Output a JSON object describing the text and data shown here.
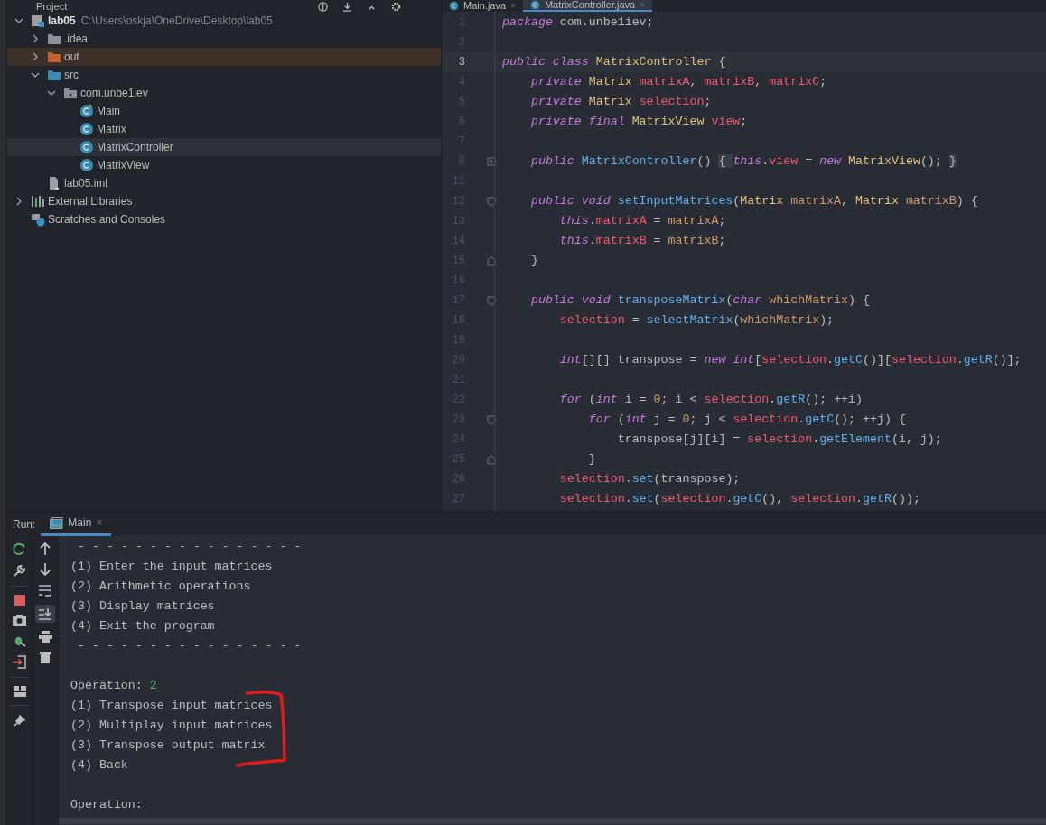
{
  "project_panel": {
    "title": "Project",
    "tree": [
      {
        "label": "lab05",
        "path": "C:\\Users\\oskja\\OneDrive\\Desktop\\lab05",
        "kind": "module",
        "expanded": true,
        "selected": false,
        "excluded": false,
        "children": [
          {
            "label": ".idea",
            "kind": "folder",
            "expanded": false,
            "selected": false,
            "excluded": false
          },
          {
            "label": "out",
            "kind": "excluded-folder",
            "expanded": false,
            "selected": false,
            "excluded": true
          },
          {
            "label": "src",
            "kind": "source-folder",
            "expanded": true,
            "selected": false,
            "excluded": false,
            "children": [
              {
                "label": "com.unbe1iev",
                "kind": "package",
                "expanded": true,
                "selected": false,
                "excluded": false,
                "children": [
                  {
                    "label": "Main",
                    "kind": "main-class",
                    "selected": false,
                    "excluded": false
                  },
                  {
                    "label": "Matrix",
                    "kind": "class",
                    "selected": false,
                    "excluded": false
                  },
                  {
                    "label": "MatrixController",
                    "kind": "class",
                    "selected": true,
                    "excluded": false
                  },
                  {
                    "label": "MatrixView",
                    "kind": "class",
                    "selected": false,
                    "excluded": false
                  }
                ]
              }
            ]
          },
          {
            "label": "lab05.iml",
            "kind": "file",
            "selected": false,
            "excluded": false
          }
        ]
      },
      {
        "label": "External Libraries",
        "kind": "libraries",
        "expanded": false,
        "selected": false,
        "excluded": false
      },
      {
        "label": "Scratches and Consoles",
        "kind": "scratches",
        "selected": false,
        "excluded": false
      }
    ]
  },
  "editor": {
    "tabs": [
      {
        "label": "Main.java",
        "close": "×",
        "selected": false
      },
      {
        "label": "MatrixController.java",
        "close": "×",
        "selected": true
      }
    ],
    "lines": [
      {
        "n": "1",
        "current": false,
        "tokens": [
          {
            "kind": "kw",
            "text": "package "
          },
          {
            "kind": "plain",
            "text": "com.unbe1iev;"
          }
        ]
      },
      {
        "n": "2",
        "current": false
      },
      {
        "n": "3",
        "current": true,
        "tokens": [
          {
            "kind": "kw",
            "text": "public class "
          },
          {
            "kind": "type",
            "text": "MatrixController"
          },
          {
            "kind": "plain",
            "text": " {"
          }
        ]
      },
      {
        "n": "4",
        "current": false,
        "tokens": [
          {
            "kind": "kw",
            "text": "    private "
          },
          {
            "kind": "type",
            "text": "Matrix "
          },
          {
            "kind": "field",
            "text": "matrixA"
          },
          {
            "kind": "plain",
            "text": ", "
          },
          {
            "kind": "field",
            "text": "matrixB"
          },
          {
            "kind": "plain",
            "text": ", "
          },
          {
            "kind": "field",
            "text": "matrixC"
          },
          {
            "kind": "plain",
            "text": ";"
          }
        ]
      },
      {
        "n": "5",
        "current": false,
        "tokens": [
          {
            "kind": "kw",
            "text": "    private "
          },
          {
            "kind": "type",
            "text": "Matrix "
          },
          {
            "kind": "field",
            "text": "selection"
          },
          {
            "kind": "plain",
            "text": ";"
          }
        ]
      },
      {
        "n": "6",
        "current": false,
        "tokens": [
          {
            "kind": "kw",
            "text": "    private final "
          },
          {
            "kind": "type",
            "text": "MatrixView "
          },
          {
            "kind": "field",
            "text": "view"
          },
          {
            "kind": "plain",
            "text": ";"
          }
        ]
      },
      {
        "n": "7",
        "current": false
      },
      {
        "n": "8",
        "current": false,
        "kind": "folded",
        "tokens": [
          {
            "kind": "kw",
            "text": "    public "
          },
          {
            "kind": "fn",
            "text": "MatrixController"
          },
          {
            "kind": "plain",
            "text": "() "
          },
          {
            "kind": "folded",
            "text": "{ "
          },
          {
            "kind": "kw",
            "text": "this"
          },
          {
            "kind": "plain",
            "text": "."
          },
          {
            "kind": "field",
            "text": "view"
          },
          {
            "kind": "plain",
            "text": " = "
          },
          {
            "kind": "kw",
            "text": "new "
          },
          {
            "kind": "type",
            "text": "MatrixView"
          },
          {
            "kind": "plain",
            "text": "(); "
          },
          {
            "kind": "folded",
            "text": "}"
          }
        ]
      },
      {
        "n": "11",
        "current": false
      },
      {
        "n": "12",
        "current": false,
        "kind": "fold-start",
        "tokens": [
          {
            "kind": "kw",
            "text": "    public void "
          },
          {
            "kind": "fn",
            "text": "setInputMatrices"
          },
          {
            "kind": "plain",
            "text": "("
          },
          {
            "kind": "type",
            "text": "Matrix "
          },
          {
            "kind": "param",
            "text": "matrixA"
          },
          {
            "kind": "plain",
            "text": ", "
          },
          {
            "kind": "type",
            "text": "Matrix "
          },
          {
            "kind": "param",
            "text": "matrixB"
          },
          {
            "kind": "plain",
            "text": ") {"
          }
        ]
      },
      {
        "n": "13",
        "current": false,
        "tokens": [
          {
            "kind": "kw",
            "text": "        this"
          },
          {
            "kind": "plain",
            "text": "."
          },
          {
            "kind": "field",
            "text": "matrixA"
          },
          {
            "kind": "plain",
            "text": " = "
          },
          {
            "kind": "param",
            "text": "matrixA"
          },
          {
            "kind": "plain",
            "text": ";"
          }
        ]
      },
      {
        "n": "14",
        "current": false,
        "tokens": [
          {
            "kind": "kw",
            "text": "        this"
          },
          {
            "kind": "plain",
            "text": "."
          },
          {
            "kind": "field",
            "text": "matrixB"
          },
          {
            "kind": "plain",
            "text": " = "
          },
          {
            "kind": "param",
            "text": "matrixB"
          },
          {
            "kind": "plain",
            "text": ";"
          }
        ]
      },
      {
        "n": "15",
        "current": false,
        "kind": "fold-end",
        "tokens": [
          {
            "kind": "plain",
            "text": "    }"
          }
        ]
      },
      {
        "n": "16",
        "current": false
      },
      {
        "n": "17",
        "current": false,
        "kind": "fold-start",
        "tokens": [
          {
            "kind": "kw",
            "text": "    public void "
          },
          {
            "kind": "fn",
            "text": "transposeMatrix"
          },
          {
            "kind": "plain",
            "text": "("
          },
          {
            "kind": "kw",
            "text": "char "
          },
          {
            "kind": "param",
            "text": "whichMatrix"
          },
          {
            "kind": "plain",
            "text": ") {"
          }
        ]
      },
      {
        "n": "18",
        "current": false,
        "tokens": [
          {
            "kind": "field",
            "text": "        selection"
          },
          {
            "kind": "plain",
            "text": " = "
          },
          {
            "kind": "fn",
            "text": "selectMatrix"
          },
          {
            "kind": "plain",
            "text": "("
          },
          {
            "kind": "param",
            "text": "whichMatrix"
          },
          {
            "kind": "plain",
            "text": ");"
          }
        ]
      },
      {
        "n": "19",
        "current": false
      },
      {
        "n": "20",
        "current": false,
        "tokens": [
          {
            "kind": "kw",
            "text": "        int"
          },
          {
            "kind": "plain",
            "text": "[][] transpose = "
          },
          {
            "kind": "kw",
            "text": "new int"
          },
          {
            "kind": "plain",
            "text": "["
          },
          {
            "kind": "field",
            "text": "selection"
          },
          {
            "kind": "plain",
            "text": "."
          },
          {
            "kind": "fn",
            "text": "getC"
          },
          {
            "kind": "plain",
            "text": "()]["
          },
          {
            "kind": "field",
            "text": "selection"
          },
          {
            "kind": "plain",
            "text": "."
          },
          {
            "kind": "fn",
            "text": "getR"
          },
          {
            "kind": "plain",
            "text": "()];"
          }
        ]
      },
      {
        "n": "21",
        "current": false
      },
      {
        "n": "22",
        "current": false,
        "tokens": [
          {
            "kind": "kw",
            "text": "        for"
          },
          {
            "kind": "plain",
            "text": " ("
          },
          {
            "kind": "kw",
            "text": "int"
          },
          {
            "kind": "plain",
            "text": " i = "
          },
          {
            "kind": "num",
            "text": "0"
          },
          {
            "kind": "plain",
            "text": "; i < "
          },
          {
            "kind": "field",
            "text": "selection"
          },
          {
            "kind": "plain",
            "text": "."
          },
          {
            "kind": "fn",
            "text": "getR"
          },
          {
            "kind": "plain",
            "text": "(); ++i)"
          }
        ]
      },
      {
        "n": "23",
        "current": false,
        "kind": "fold-start",
        "tokens": [
          {
            "kind": "kw",
            "text": "            for"
          },
          {
            "kind": "plain",
            "text": " ("
          },
          {
            "kind": "kw",
            "text": "int"
          },
          {
            "kind": "plain",
            "text": " j = "
          },
          {
            "kind": "num",
            "text": "0"
          },
          {
            "kind": "plain",
            "text": "; j < "
          },
          {
            "kind": "field",
            "text": "selection"
          },
          {
            "kind": "plain",
            "text": "."
          },
          {
            "kind": "fn",
            "text": "getC"
          },
          {
            "kind": "plain",
            "text": "(); ++j) {"
          }
        ]
      },
      {
        "n": "24",
        "current": false,
        "tokens": [
          {
            "kind": "plain",
            "text": "                transpose[j][i] = "
          },
          {
            "kind": "field",
            "text": "selection"
          },
          {
            "kind": "plain",
            "text": "."
          },
          {
            "kind": "fn",
            "text": "getElement"
          },
          {
            "kind": "plain",
            "text": "(i, j);"
          }
        ]
      },
      {
        "n": "25",
        "current": false,
        "kind": "fold-end",
        "tokens": [
          {
            "kind": "plain",
            "text": "            }"
          }
        ]
      },
      {
        "n": "26",
        "current": false,
        "tokens": [
          {
            "kind": "field",
            "text": "        selection"
          },
          {
            "kind": "plain",
            "text": "."
          },
          {
            "kind": "fn",
            "text": "set"
          },
          {
            "kind": "plain",
            "text": "(transpose);"
          }
        ]
      },
      {
        "n": "27",
        "current": false,
        "tokens": [
          {
            "kind": "field",
            "text": "        selection"
          },
          {
            "kind": "plain",
            "text": "."
          },
          {
            "kind": "fn",
            "text": "set"
          },
          {
            "kind": "plain",
            "text": "("
          },
          {
            "kind": "field",
            "text": "selection"
          },
          {
            "kind": "plain",
            "text": "."
          },
          {
            "kind": "fn",
            "text": "getC"
          },
          {
            "kind": "plain",
            "text": "(), "
          },
          {
            "kind": "field",
            "text": "selection"
          },
          {
            "kind": "plain",
            "text": "."
          },
          {
            "kind": "fn",
            "text": "getR"
          },
          {
            "kind": "plain",
            "text": "());"
          }
        ]
      }
    ]
  },
  "run_panel": {
    "label": "Run:",
    "tabs": [
      {
        "label": "Main",
        "close": "×",
        "selected": true
      }
    ],
    "console": [
      {
        "kind": "text",
        "text": " - - - - - - - - - - - - - - - -"
      },
      {
        "kind": "text",
        "text": "(1) Enter the input matrices"
      },
      {
        "kind": "text",
        "text": "(2) Arithmetic operations"
      },
      {
        "kind": "text",
        "text": "(3) Display matrices"
      },
      {
        "kind": "text",
        "text": "(4) Exit the program"
      },
      {
        "kind": "text",
        "text": " - - - - - - - - - - - - - - - -"
      },
      {
        "kind": "blank"
      },
      {
        "kind": "prompt",
        "text": "Operation:",
        "input": "2"
      },
      {
        "kind": "text",
        "text": "(1) Transpose input matrices"
      },
      {
        "kind": "text",
        "text": "(2) Multiplay input matrices"
      },
      {
        "kind": "text",
        "text": "(3) Transpose output matrix"
      },
      {
        "kind": "text",
        "text": "(4) Back"
      },
      {
        "kind": "blank"
      },
      {
        "kind": "prompt",
        "text": "Operation:"
      }
    ]
  }
}
